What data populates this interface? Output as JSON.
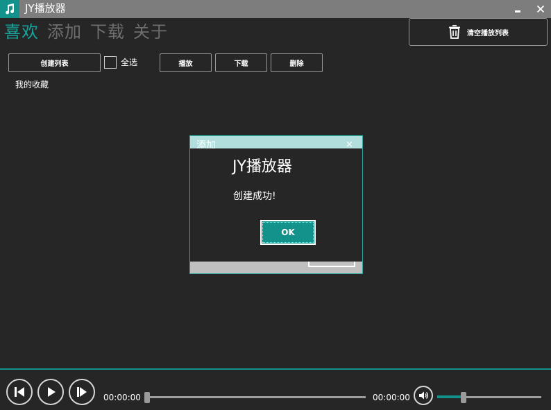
{
  "window": {
    "title": "JY播放器",
    "icon": "music-note-icon",
    "accent": "#13928c",
    "minimize_icon": "minimize-icon",
    "close_icon": "close-icon"
  },
  "nav": {
    "tabs": [
      {
        "label": "喜欢",
        "active": true
      },
      {
        "label": "添加",
        "active": false
      },
      {
        "label": "下载",
        "active": false
      },
      {
        "label": "关于",
        "active": false
      }
    ]
  },
  "header": {
    "clear_label": "清空播放列表",
    "clear_icon": "trash-icon"
  },
  "toolbar": {
    "create_label": "创建列表",
    "select_all_label": "全选",
    "select_all_checked": false,
    "play_label": "播放",
    "download_label": "下载",
    "delete_label": "删除"
  },
  "playlists": [
    {
      "name": "我的收藏"
    }
  ],
  "dialog_behind": {
    "title": "添加",
    "close": "×"
  },
  "dialog": {
    "title": "JY播放器",
    "message": "创建成功!",
    "ok_label": "OK"
  },
  "player": {
    "current_time": "00:00:00",
    "total_time": "00:00:00",
    "progress": 0.0,
    "volume": 0.5,
    "prev_icon": "skip-previous-icon",
    "play_icon": "play-icon",
    "next_icon": "skip-next-icon",
    "volume_icon": "volume-icon"
  }
}
